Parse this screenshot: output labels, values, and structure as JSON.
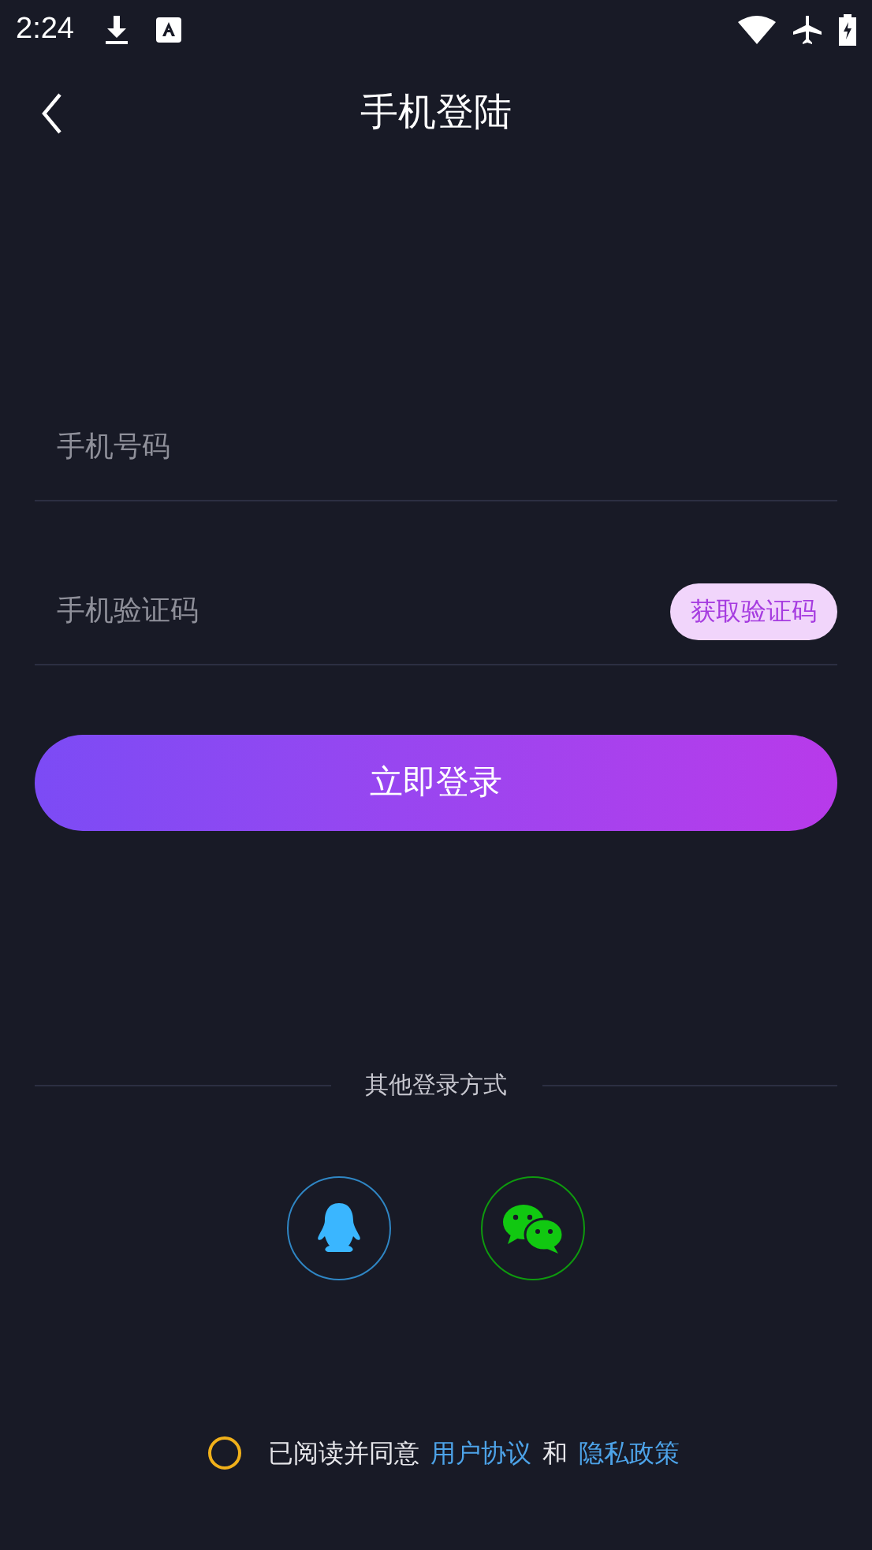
{
  "status_bar": {
    "time": "2:24"
  },
  "header": {
    "title": "手机登陆"
  },
  "fields": [
    {
      "placeholder": "手机号码"
    },
    {
      "placeholder": "手机验证码",
      "action": "获取验证码"
    }
  ],
  "login_button": "立即登录",
  "other_login": {
    "label": "其他登录方式",
    "providers": [
      {
        "kind": "qq"
      },
      {
        "kind": "wechat"
      }
    ]
  },
  "agreement": {
    "checked": false,
    "parts": [
      {
        "kind": "text",
        "text": "已阅读并同意"
      },
      {
        "kind": "link",
        "text": "用户协议"
      },
      {
        "kind": "text",
        "text": "和"
      },
      {
        "kind": "link",
        "text": "隐私政策"
      }
    ]
  }
}
